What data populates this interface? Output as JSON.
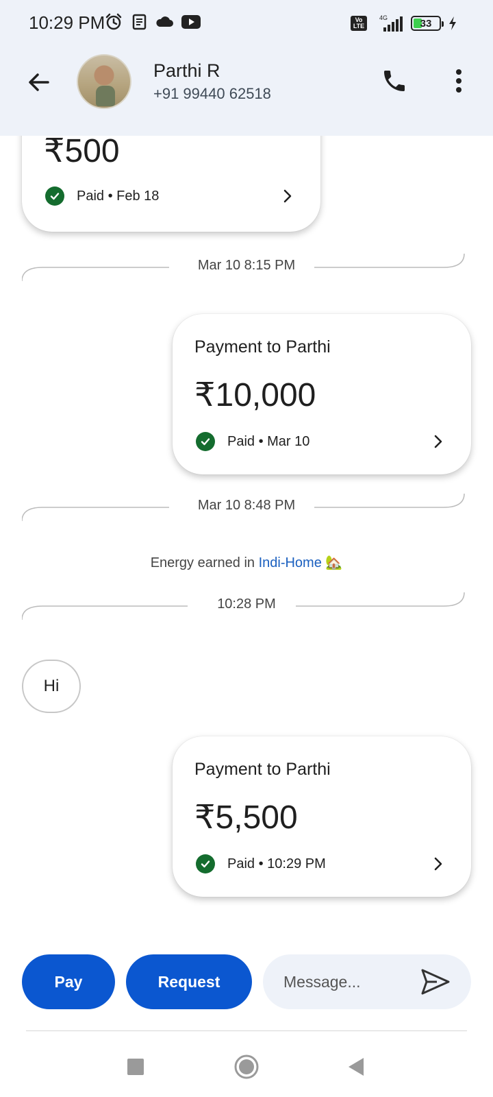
{
  "status_bar": {
    "time": "10:29 PM",
    "left_icons": [
      "alarm-icon",
      "notes-icon",
      "cloud-icon",
      "youtube-icon"
    ],
    "network_label": "4G",
    "lte_top": "Vo",
    "lte_bottom": "LTE",
    "battery": "33"
  },
  "header": {
    "name": "Parthi R",
    "phone": "+91 99440 62518"
  },
  "chat": {
    "payment_1": {
      "amount": "₹500",
      "status": "Paid • Feb 18"
    },
    "divider_1": "Mar 10 8:15 PM",
    "payment_2": {
      "title": "Payment to Parthi",
      "amount": "₹10,000",
      "status": "Paid • Mar 10"
    },
    "divider_2": "Mar 10 8:48 PM",
    "info": {
      "prefix": "Energy earned in ",
      "link": "Indi-Home",
      "emoji": "🏡"
    },
    "divider_3": "10:28 PM",
    "message": "Hi",
    "payment_3": {
      "title": "Payment to Parthi",
      "amount": "₹5,500",
      "status": "Paid • 10:29 PM"
    }
  },
  "composer": {
    "pay_label": "Pay",
    "request_label": "Request",
    "placeholder": "Message..."
  },
  "colors": {
    "accent": "#0b57d0",
    "header_bg": "#eef2f9",
    "paid_green": "#146c2e",
    "link": "#1a5fbf"
  }
}
